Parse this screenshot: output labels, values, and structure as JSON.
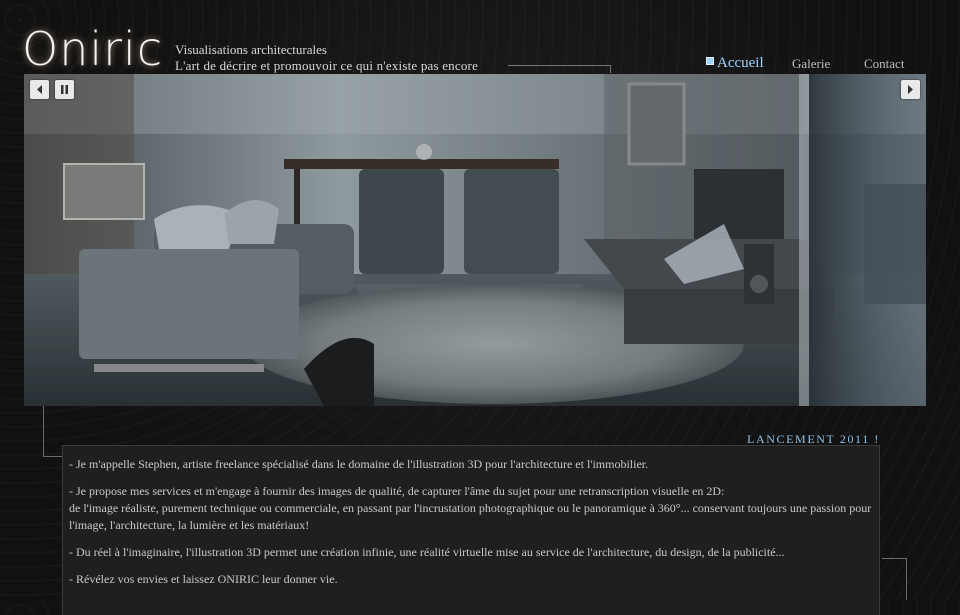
{
  "brand": {
    "logo_text": "Oniric",
    "tagline_1": "Visualisations architecturales",
    "tagline_2": "L'art de décrire et promouvoir ce qui n'existe pas encore"
  },
  "nav": {
    "items": [
      {
        "label": "Accueil",
        "active": true
      },
      {
        "label": "Galerie",
        "active": false
      },
      {
        "label": "Contact",
        "active": false
      }
    ]
  },
  "slider": {
    "image_desc": "3D rendered living room interior",
    "prev_icon": "chevron-left-icon",
    "pause_icon": "pause-icon",
    "next_icon": "chevron-right-icon"
  },
  "announcement": "LANCEMENT 2011 !",
  "content": {
    "p1": "- Je m'appelle Stephen, artiste freelance spécialisé dans le domaine de l'illustration 3D pour l'architecture et l'immobilier.",
    "p2a": "- Je propose mes services et m'engage à fournir des images de qualité, de capturer l'âme du sujet pour une retranscription visuelle en 2D:",
    "p2b": "de l'image réaliste, purement technique ou commerciale, en passant par l'incrustation photographique ou le panoramique à 360°... conservant toujours une passion pour l'image, l'architecture, la lumière et les matériaux!",
    "p3": "- Du réel à l'imaginaire, l'illustration 3D permet une création infinie, une réalité virtuelle mise au service de l'architecture, du design, de la publicité...",
    "p4": "- Révélez vos envies et laissez ONIRIC leur donner vie."
  },
  "colors": {
    "background": "#111111",
    "accent": "#9fd3ff",
    "panel": "#1f1f1f"
  }
}
